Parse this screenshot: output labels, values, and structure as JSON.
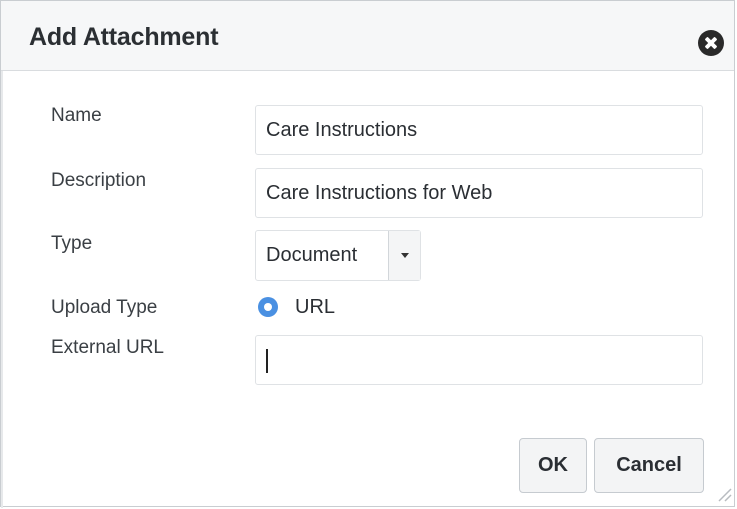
{
  "dialog": {
    "title": "Add Attachment"
  },
  "form": {
    "name": {
      "label": "Name",
      "value": "Care Instructions"
    },
    "description": {
      "label": "Description",
      "value": "Care Instructions for Web"
    },
    "type": {
      "label": "Type",
      "selected": "Document"
    },
    "upload_type": {
      "label": "Upload Type",
      "option": "URL",
      "selected": true
    },
    "external_url": {
      "label": "External URL",
      "value": ""
    }
  },
  "buttons": {
    "ok": "OK",
    "cancel": "Cancel"
  },
  "colors": {
    "radio_accent": "#4a90e2",
    "header_bg": "#f6f7f8"
  },
  "icons": {
    "close": "close-icon",
    "dropdown": "chevron-down-icon",
    "resize": "resize-grip-icon"
  }
}
